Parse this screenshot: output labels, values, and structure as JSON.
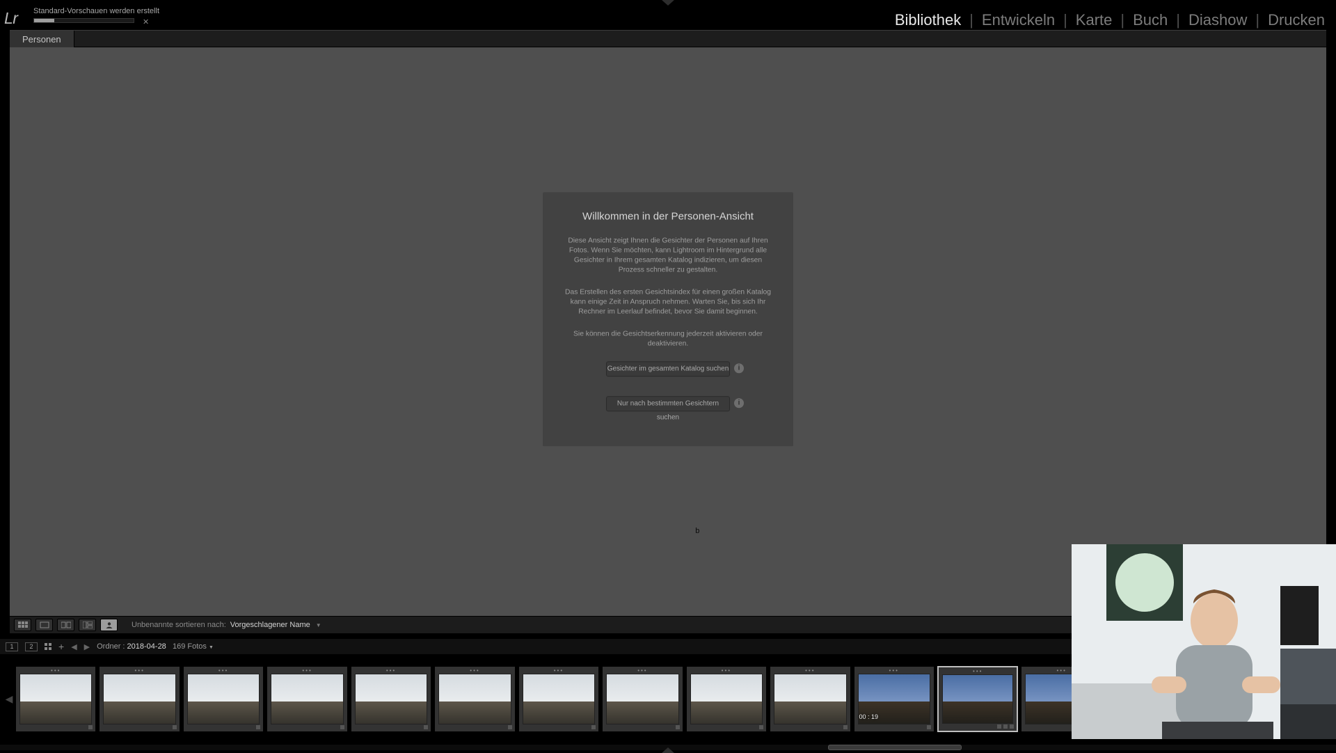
{
  "task": {
    "label": "Standard-Vorschauen werden erstellt"
  },
  "modules": {
    "items": [
      "Bibliothek",
      "Entwickeln",
      "Karte",
      "Buch",
      "Diashow",
      "Drucken"
    ],
    "active": "Bibliothek"
  },
  "tabs": {
    "active": "Personen"
  },
  "dialog": {
    "title": "Willkommen in der Personen-Ansicht",
    "p1": "Diese Ansicht zeigt Ihnen die Gesichter der Personen auf Ihren Fotos. Wenn Sie möchten, kann Lightroom im Hintergrund alle Gesichter in Ihrem gesamten Katalog indizieren, um diesen Prozess schneller zu gestalten.",
    "p2": "Das Erstellen des ersten Gesichtsindex für einen großen Katalog kann einige Zeit in Anspruch nehmen. Warten Sie, bis sich Ihr Rechner im Leerlauf befindet, bevor Sie damit beginnen.",
    "p3": "Sie können die Gesichtserkennung jederzeit aktivieren oder deaktivieren.",
    "btn1": "Gesichter im gesamten Katalog suchen",
    "btn2": "Nur nach bestimmten Gesichtern suchen"
  },
  "toolbar": {
    "sort_label": "Unbenannte sortieren nach:",
    "sort_value": "Vorgeschlagener Name"
  },
  "filmstrip_header": {
    "mon1": "1",
    "mon2": "2",
    "path_prefix": "Ordner : ",
    "path_value": "2018-04-28",
    "count": "169 Fotos"
  },
  "thumbs": {
    "video_tc": "00 : 19"
  },
  "cursor_text": "b"
}
